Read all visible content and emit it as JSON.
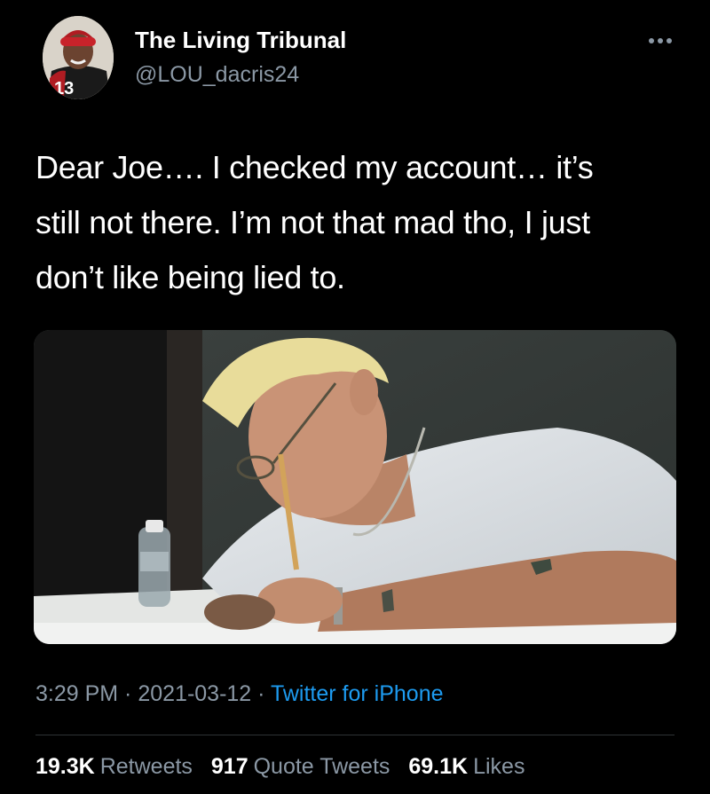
{
  "author": {
    "display_name": "The Living Tribunal",
    "handle": "@LOU_dacris24",
    "avatar_jersey_number": "13"
  },
  "more_icon": "more-horizontal-icon",
  "tweet": {
    "lines": [
      "Dear Joe…. I checked my account… it’s",
      "still not there. I’m not that mad tho, I just",
      "don’t like being lied to."
    ]
  },
  "meta": {
    "time": "3:29 PM",
    "sep1": " · ",
    "date": "2021-03-12",
    "sep2": " · ",
    "source": "Twitter for iPhone"
  },
  "stats": {
    "retweets_count": "19.3K",
    "retweets_label": "Retweets",
    "quotes_count": "917",
    "quotes_label": "Quote Tweets",
    "likes_count": "69.1K",
    "likes_label": "Likes"
  },
  "colors": {
    "background": "#000000",
    "text_primary": "#ffffff",
    "text_secondary": "#8b98a5",
    "link": "#1d9bf0",
    "divider": "#2f3336"
  }
}
